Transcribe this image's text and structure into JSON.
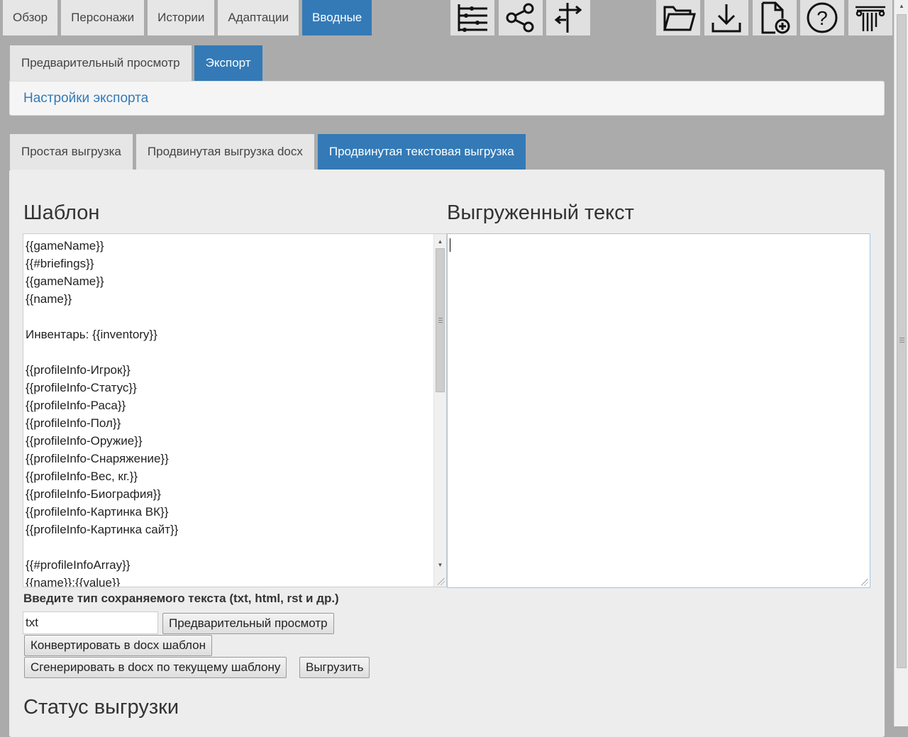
{
  "topnav": {
    "tabs": [
      {
        "label": "Обзор"
      },
      {
        "label": "Персонажи"
      },
      {
        "label": "Истории"
      },
      {
        "label": "Адаптации"
      },
      {
        "label": "Вводные"
      }
    ],
    "active_tab": "Вводные"
  },
  "toolbar_icons": [
    "timeline-icon",
    "share-network-icon",
    "signpost-icon",
    "folder-open-icon",
    "download-icon",
    "new-document-icon",
    "help-icon",
    "column-logo-icon"
  ],
  "subnav": {
    "tabs": [
      {
        "label": "Предварительный просмотр"
      },
      {
        "label": "Экспорт"
      }
    ],
    "active_tab": "Экспорт"
  },
  "export_settings_link": "Настройки экспорта",
  "export_tabs": {
    "tabs": [
      {
        "label": "Простая выгрузка"
      },
      {
        "label": "Продвинутая выгрузка docx"
      },
      {
        "label": "Продвинутая текстовая выгрузка"
      }
    ],
    "active_tab": "Продвинутая текстовая выгрузка"
  },
  "template_section": {
    "title": "Шаблон",
    "lines": [
      "{{gameName}}",
      "{{#briefings}}",
      "{{gameName}}",
      "{{name}}",
      "",
      "Инвентарь: {{inventory}}",
      "",
      "{{profileInfo-Игрок}}",
      "{{profileInfo-Статус}}",
      "{{profileInfo-Раса}}",
      "{{profileInfo-Пол}}",
      "{{profileInfo-Оружие}}",
      "{{profileInfo-Снаряжение}}",
      "{{profileInfo-Вес, кг.}}",
      "{{profileInfo-Биография}}",
      "{{profileInfo-Картинка ВК}}",
      "{{profileInfo-Картинка сайт}}",
      "",
      "{{#profileInfoArray}}",
      "{{name}}:{{value}}"
    ]
  },
  "output_section": {
    "title": "Выгруженный текст",
    "value": ""
  },
  "file_type": {
    "label": "Введите тип сохраняемого текста (txt, html, rst и др.)",
    "value": "txt"
  },
  "buttons": {
    "preview": "Предварительный просмотр",
    "convert_docx": "Конвертировать в docx шаблон",
    "generate_docx": "Сгенерировать в docx по текущему шаблону",
    "export": "Выгрузить"
  },
  "status_section": {
    "title": "Статус выгрузки"
  },
  "colors": {
    "active_tab": "#337ab7",
    "page_bg": "#ababab",
    "content_bg": "#ededed"
  }
}
